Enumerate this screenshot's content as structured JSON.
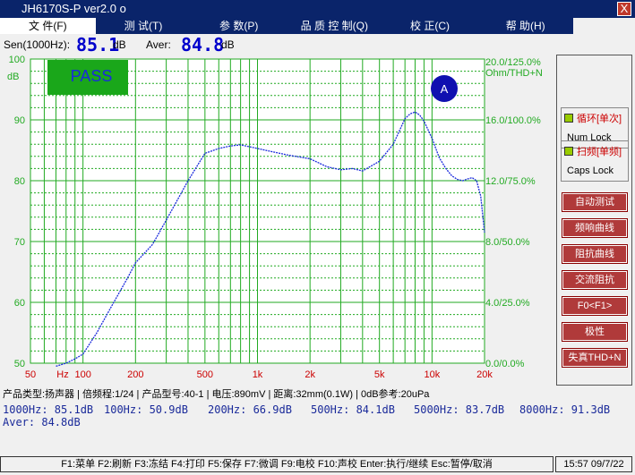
{
  "window": {
    "title": "JH6170S-P   ver2.0  o",
    "close": "X"
  },
  "menu": [
    {
      "label": "文 件(F)"
    },
    {
      "label": "测 试(T)"
    },
    {
      "label": "参 数(P)"
    },
    {
      "label": "品 质 控 制(Q)"
    },
    {
      "label": "校 正(C)"
    },
    {
      "label": "帮 助(H)"
    }
  ],
  "readout": {
    "sen_label": "Sen(1000Hz):",
    "sen_value": "85.1",
    "sen_unit": "dB",
    "aver_label": "Aver:",
    "aver_value": "84.8",
    "aver_unit": "dB"
  },
  "plot": {
    "pass_label": "PASS",
    "badge": "A",
    "left_unit": "dB",
    "right_unit_line1": "20.0/125.0%",
    "right_unit_line2": "Ohm/THD+N",
    "hz_label": "Hz",
    "colors": {
      "grid": "#22aa22",
      "curve": "#1a2adc",
      "pass_bg": "#1aa71a",
      "badge": "#1010b0"
    }
  },
  "chart_data": {
    "type": "line",
    "xlabel": "Hz",
    "ylabel": "dB",
    "xscale": "log",
    "xlim": [
      50,
      20000
    ],
    "ylim": [
      50,
      100
    ],
    "x_ticks": [
      "50",
      "100",
      "200",
      "500",
      "1k",
      "2k",
      "5k",
      "10k",
      "20k"
    ],
    "x_tick_values": [
      50,
      100,
      200,
      500,
      1000,
      2000,
      5000,
      10000,
      20000
    ],
    "y_ticks": [
      "100",
      "90",
      "80",
      "70",
      "60",
      "50"
    ],
    "y_tick_values": [
      100,
      90,
      80,
      70,
      60,
      50
    ],
    "right_ticks": [
      "20.0/125.0%",
      "16.0/100.0%",
      "12.0/75.0%",
      "8.0/50.0%",
      "4.0/25.0%",
      "0.0/0.0%"
    ],
    "grid": true,
    "series": [
      {
        "x": [
          70,
          80,
          90,
          100,
          120,
          150,
          180,
          200,
          250,
          300,
          400,
          500,
          600,
          700,
          800,
          1000,
          1200,
          1500,
          2000,
          2500,
          3000,
          3500,
          4000,
          5000,
          6000,
          7000,
          7500,
          8000,
          8500,
          9000,
          10000,
          11000,
          12000,
          13000,
          14000,
          15000,
          16000,
          17000,
          18000,
          19000,
          20000
        ],
        "y": [
          49.5,
          50.0,
          50.7,
          51.5,
          55.0,
          60.0,
          64.0,
          66.5,
          69.5,
          73.5,
          80.0,
          84.5,
          85.3,
          85.7,
          85.9,
          85.3,
          84.8,
          84.2,
          83.6,
          82.3,
          81.8,
          82.0,
          81.6,
          83.2,
          86.0,
          90.2,
          91.0,
          91.3,
          90.8,
          89.8,
          87.0,
          83.8,
          82.0,
          80.8,
          80.2,
          80.0,
          80.3,
          80.5,
          80.0,
          77.5,
          71.5
        ]
      }
    ]
  },
  "panel": {
    "lock1_a": "循环[单次]",
    "lock1_b": "Num Lock",
    "lock2_a": "扫频[单频]",
    "lock2_b": "Caps Lock",
    "buttons": [
      "自动测试",
      "频响曲线",
      "阻抗曲线",
      "交流阻抗",
      "F0<F1>",
      "极性",
      "失真THD+N"
    ]
  },
  "info": "产品类型:扬声器 | 倍频程:1/24 | 产品型号:40-1 | 电压:890mV | 距离:32mm(0.1W) | 0dB参考:20uPa",
  "results": {
    "r1": "1000Hz:  85.1dB",
    "r2": "100Hz:  50.9dB",
    "r3": "200Hz:  66.9dB",
    "r4": "500Hz:  84.1dB",
    "r5": "5000Hz:  83.7dB",
    "r6": "8000Hz:  91.3dB",
    "r7": "Aver:  84.8dB"
  },
  "statusbar": "F1:菜单 F2:刷新 F3:冻结 F4:打印 F5:保存 F7:微调 F9:电校 F10:声校 Enter:执行/继续  Esc:暂停/取消",
  "clock": "15:57  09/7/22"
}
